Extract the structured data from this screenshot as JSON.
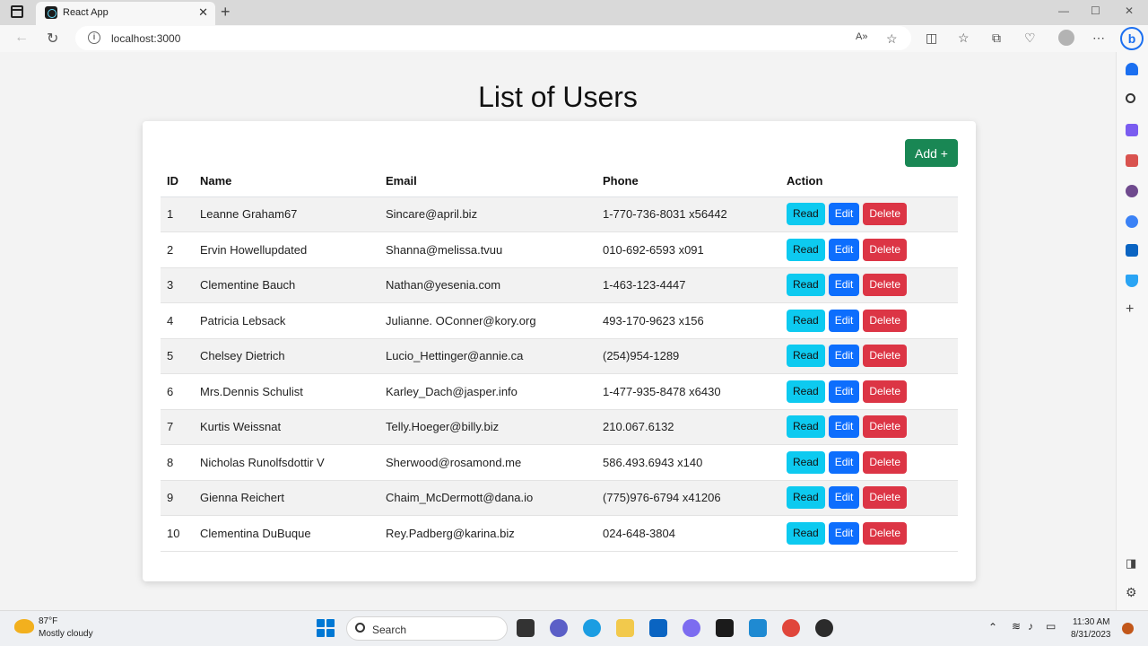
{
  "browser": {
    "tab_title": "React App",
    "tab_close": "✕",
    "new_tab": "+",
    "url": "localhost:3000",
    "window_controls": [
      "—",
      "☐",
      "✕"
    ]
  },
  "page": {
    "title": "List of Users",
    "add_button": "Add +"
  },
  "table": {
    "headers": [
      "ID",
      "Name",
      "Email",
      "Phone",
      "Action"
    ],
    "action_labels": {
      "read": "Read",
      "edit": "Edit",
      "delete": "Delete"
    },
    "rows": [
      {
        "id": "1",
        "name": "Leanne Graham67",
        "email": "Sincare@april.biz",
        "phone": "1-770-736-8031 x56442"
      },
      {
        "id": "2",
        "name": "Ervin Howellupdated",
        "email": "Shanna@melissa.tvuu",
        "phone": "010-692-6593 x091"
      },
      {
        "id": "3",
        "name": "Clementine Bauch",
        "email": "Nathan@yesenia.com",
        "phone": "1-463-123-4447"
      },
      {
        "id": "4",
        "name": "Patricia Lebsack",
        "email": "Julianne. OConner@kory.org",
        "phone": "493-170-9623 x156"
      },
      {
        "id": "5",
        "name": "Chelsey Dietrich",
        "email": "Lucio_Hettinger@annie.ca",
        "phone": "(254)954-1289"
      },
      {
        "id": "6",
        "name": "Mrs.Dennis Schulist",
        "email": "Karley_Dach@jasper.info",
        "phone": "1-477-935-8478 x6430"
      },
      {
        "id": "7",
        "name": "Kurtis Weissnat",
        "email": "Telly.Hoeger@billy.biz",
        "phone": "210.067.6132"
      },
      {
        "id": "8",
        "name": "Nicholas Runolfsdottir V",
        "email": "Sherwood@rosamond.me",
        "phone": "586.493.6943 x140"
      },
      {
        "id": "9",
        "name": "Gienna Reichert",
        "email": "Chaim_McDermott@dana.io",
        "phone": "(775)976-6794 x41206"
      },
      {
        "id": "10",
        "name": "Clementina DuBuque",
        "email": "Rey.Padberg@karina.biz",
        "phone": "024-648-3804"
      }
    ]
  },
  "taskbar": {
    "weather_temp": "87°F",
    "weather_desc": "Mostly cloudy",
    "search_placeholder": "Search",
    "time": "11:30 AM",
    "date": "8/31/2023"
  },
  "colors": {
    "read": "#0dcaf0",
    "edit": "#0d6efd",
    "delete": "#dc3545",
    "add": "#198754"
  }
}
